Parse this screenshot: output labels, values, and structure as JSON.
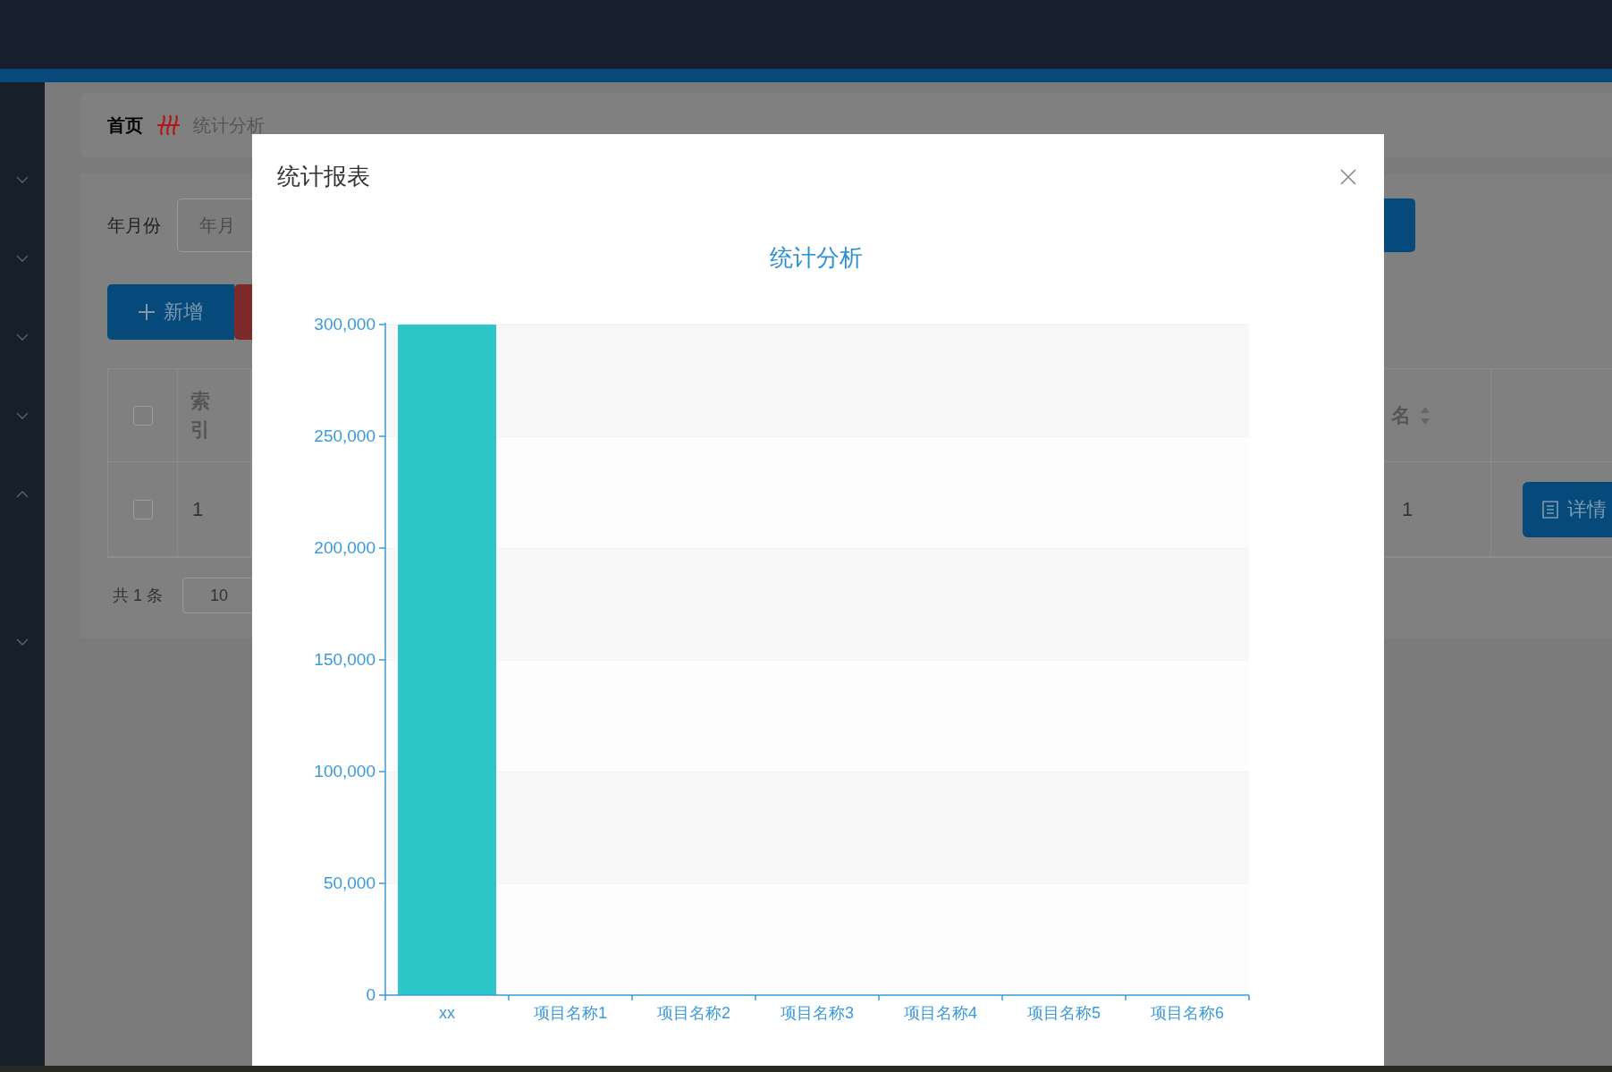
{
  "sidebar": {
    "items": [
      {
        "expanded": false
      },
      {
        "expanded": false
      },
      {
        "expanded": false
      },
      {
        "expanded": false
      },
      {
        "expanded": true
      },
      {
        "expanded": false
      }
    ]
  },
  "breadcrumb": [
    {
      "label": "首页",
      "kind": "home"
    },
    {
      "label": "统计分析",
      "kind": "current"
    }
  ],
  "filter": {
    "label": "年月份",
    "placeholder": "年月"
  },
  "toolbar": {
    "add_button": "新增"
  },
  "table": {
    "header": {
      "checked": false,
      "index_label": "索引",
      "name_label": "名"
    },
    "rows": [
      {
        "checked": false,
        "index": "1",
        "name": "1",
        "action": "详情"
      }
    ]
  },
  "pagination": {
    "total": "共 1 条",
    "page_size": "10"
  },
  "dialog": {
    "title": "统计报表",
    "chart_data": {
      "type": "bar",
      "title": "统计分析",
      "categories": [
        "xx",
        "项目名称1",
        "项目名称2",
        "项目名称3",
        "项目名称4",
        "项目名称5",
        "项目名称6"
      ],
      "grid": true,
      "series": [
        {
          "color": "#2ec7c9",
          "values": [
            300000,
            0,
            0,
            0,
            0,
            0,
            0
          ]
        }
      ],
      "ylim": [
        0,
        300000
      ],
      "yticks": [
        {
          "value": 0,
          "label": "0"
        },
        {
          "value": 50000,
          "label": "50,000"
        },
        {
          "value": 100000,
          "label": "100,000"
        },
        {
          "value": 150000,
          "label": "150,000"
        },
        {
          "value": 200000,
          "label": "200,000"
        },
        {
          "value": 250000,
          "label": "250,000"
        },
        {
          "value": 300000,
          "label": "300,000"
        }
      ]
    }
  }
}
